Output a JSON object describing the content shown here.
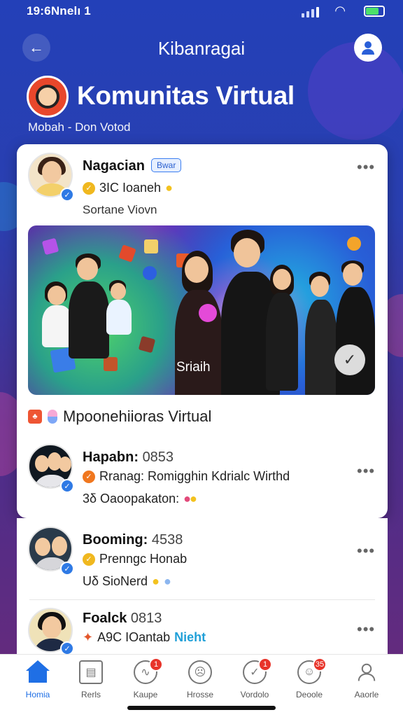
{
  "status_bar": {
    "time": "19:6Nnelı 1",
    "wifi_icon": "wifi-icon",
    "battery_icon": "battery-icon"
  },
  "header": {
    "title": "Kibanragai",
    "back_icon": "back-arrow-icon",
    "profile_icon": "user-icon"
  },
  "community": {
    "name": "Komunitas Virtual",
    "subtitle": "Mobah - Don Votod"
  },
  "featured_post": {
    "author": "Nagacian",
    "author_chip": "Bwar",
    "meta": "3IC Ioaneh",
    "subtitle": "Sortane Viovn",
    "media_caption": "Sriaih"
  },
  "section_title": "Mpoonehiioras Virtual",
  "posts": [
    {
      "name": "Hapabn:",
      "name_suffix": "0853",
      "line": "Rranag: Romigghin Kdrialc Wirthd",
      "stats": "3δ  Oaoopakaton:",
      "status_color": "#f0771f"
    },
    {
      "name": "Booming:",
      "name_suffix": "4538",
      "line": "Prenngc Honab",
      "stats": "Uδ  SioNerd",
      "status_color": "#f0b81f"
    },
    {
      "name": "Foalck",
      "name_suffix": "0813",
      "line": "",
      "stats": "A9C IOantab",
      "highlight": "Nieht",
      "status_color": "#e3562b"
    }
  ],
  "tabs": [
    {
      "label": "Homia",
      "active": true,
      "badge": ""
    },
    {
      "label": "Rerls",
      "active": false,
      "badge": ""
    },
    {
      "label": "Kaupe",
      "active": false,
      "badge": "1"
    },
    {
      "label": "Hrosse",
      "active": false,
      "badge": ""
    },
    {
      "label": "Vordolo",
      "active": false,
      "badge": "1"
    },
    {
      "label": "Deoole",
      "active": false,
      "badge": "35"
    },
    {
      "label": "Aaorle",
      "active": false,
      "badge": ""
    }
  ],
  "colors": {
    "accent": "#1f6fe5",
    "header_bg": "#2340b8",
    "badge": "#e8342a"
  }
}
